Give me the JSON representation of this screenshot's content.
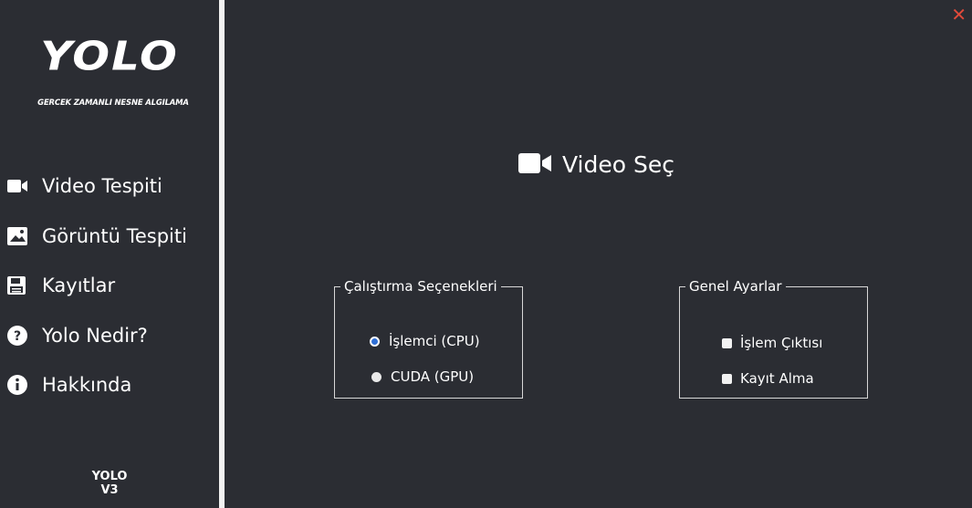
{
  "sidebar": {
    "logo": "YOLO",
    "subtitle": "GERCEK ZAMANLI NESNE ALGILAMA",
    "items": [
      {
        "label": "Video Tespiti",
        "icon": "video-camera-icon"
      },
      {
        "label": "Görüntü Tespiti",
        "icon": "image-icon"
      },
      {
        "label": "Kayıtlar",
        "icon": "save-icon"
      },
      {
        "label": "Yolo Nedir?",
        "icon": "question-icon"
      },
      {
        "label": "Hakkında",
        "icon": "info-icon"
      }
    ],
    "footer_line1": "YOLO",
    "footer_line2": "V3"
  },
  "window": {
    "close_label": "✕",
    "close_color": "#e04a3a"
  },
  "main": {
    "title": "Video Seç",
    "title_icon": "video-camera-icon",
    "run_options": {
      "legend": "Çalıştırma Seçenekleri",
      "cpu_label": "İşlemci (CPU)",
      "gpu_label": "CUDA (GPU)",
      "selected": "cpu"
    },
    "general": {
      "legend": "Genel Ayarlar",
      "output_label": "İşlem Çıktısı",
      "record_label": "Kayıt Alma"
    }
  },
  "colors": {
    "background": "#2b2d33",
    "divider": "#f2f2f2",
    "radio_accent": "#2f6fd6"
  }
}
